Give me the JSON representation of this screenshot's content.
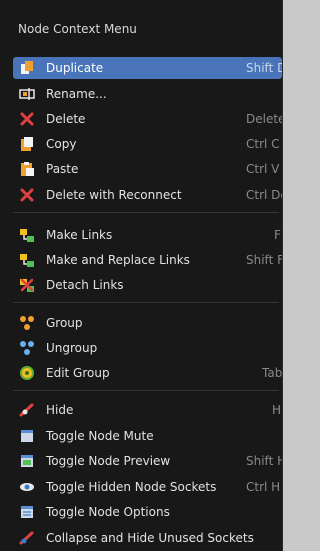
{
  "menu": {
    "title": "Node Context Menu",
    "items": [
      {
        "label": "Duplicate",
        "shortcut": "Shift D",
        "icon": "duplicate-icon"
      },
      {
        "label": "Rename...",
        "shortcut": "",
        "icon": "rename-icon"
      },
      {
        "label": "Delete",
        "shortcut": "Delete",
        "icon": "delete-icon"
      },
      {
        "label": "Copy",
        "shortcut": "Ctrl C",
        "icon": "copy-icon"
      },
      {
        "label": "Paste",
        "shortcut": "Ctrl V",
        "icon": "paste-icon"
      },
      {
        "label": "Delete with Reconnect",
        "shortcut": "Ctrl Delete",
        "icon": "delete-reconnect-icon"
      },
      {
        "label": "Make Links",
        "shortcut": "F",
        "icon": "make-links-icon"
      },
      {
        "label": "Make and Replace Links",
        "shortcut": "Shift F",
        "icon": "make-replace-links-icon"
      },
      {
        "label": "Detach Links",
        "shortcut": "",
        "icon": "detach-links-icon"
      },
      {
        "label": "Group",
        "shortcut": "",
        "icon": "group-icon"
      },
      {
        "label": "Ungroup",
        "shortcut": "",
        "icon": "ungroup-icon"
      },
      {
        "label": "Edit Group",
        "shortcut": "Tab",
        "icon": "edit-group-icon"
      },
      {
        "label": "Hide",
        "shortcut": "H",
        "icon": "hide-icon"
      },
      {
        "label": "Toggle Node Mute",
        "shortcut": "",
        "icon": "toggle-mute-icon"
      },
      {
        "label": "Toggle Node Preview",
        "shortcut": "Shift H",
        "icon": "toggle-preview-icon"
      },
      {
        "label": "Toggle Hidden Node Sockets",
        "shortcut": "Ctrl H",
        "icon": "toggle-sockets-icon"
      },
      {
        "label": "Toggle Node Options",
        "shortcut": "",
        "icon": "toggle-options-icon"
      },
      {
        "label": "Collapse and Hide Unused Sockets",
        "shortcut": "",
        "icon": "collapse-sockets-icon"
      }
    ]
  },
  "colors": {
    "menu_background": "#181818",
    "highlight": "#4a74b9",
    "text": "#e2e2e2",
    "shortcut_text": "#8a8a8a"
  }
}
